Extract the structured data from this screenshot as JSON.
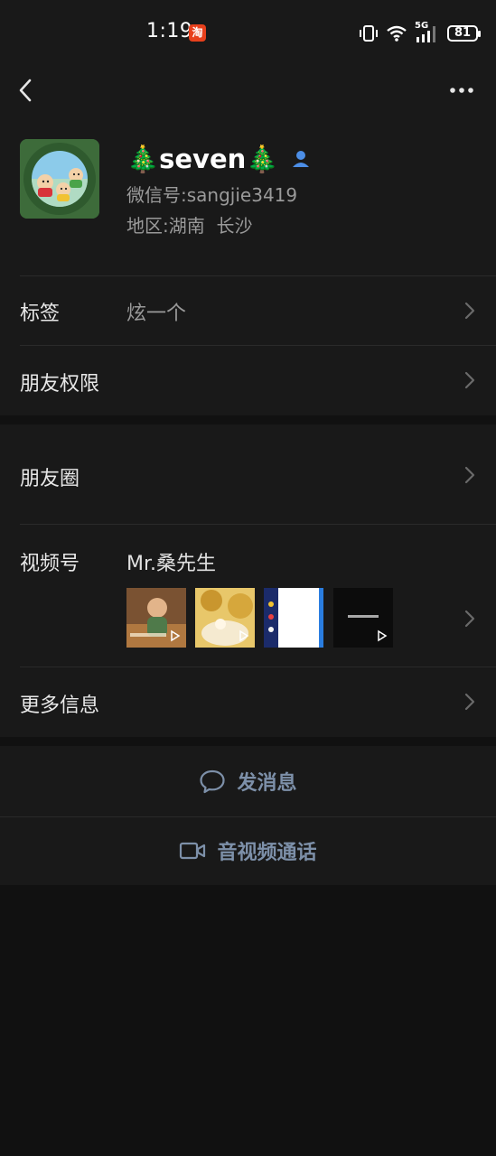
{
  "status_bar": {
    "time": "1:19",
    "app_badge": "淘",
    "network": "5G",
    "battery": "81"
  },
  "profile": {
    "nickname": "🎄seven🎄",
    "wechat_id_label": "微信号:",
    "wechat_id": "sangjie3419",
    "region_label": "地区:",
    "region": "湖南  长沙"
  },
  "rows": {
    "tags_label": "标签",
    "tags_value": "炫一个",
    "permissions_label": "朋友权限",
    "moments_label": "朋友圈",
    "channels_label": "视频号",
    "channels_value": "Mr.桑先生",
    "more_info_label": "更多信息"
  },
  "actions": {
    "send_message": "发消息",
    "video_call": "音视频通话"
  },
  "icons": {
    "back": "chevron-left-icon",
    "more": "more-dots-icon",
    "chevron": "chevron-right-icon",
    "message": "chat-bubble-icon",
    "video": "video-camera-icon",
    "contact": "person-icon"
  },
  "colors": {
    "background": "#111111",
    "surface": "#191919",
    "accent_text": "#7d90a9",
    "secondary_text": "#9a9a9a"
  }
}
